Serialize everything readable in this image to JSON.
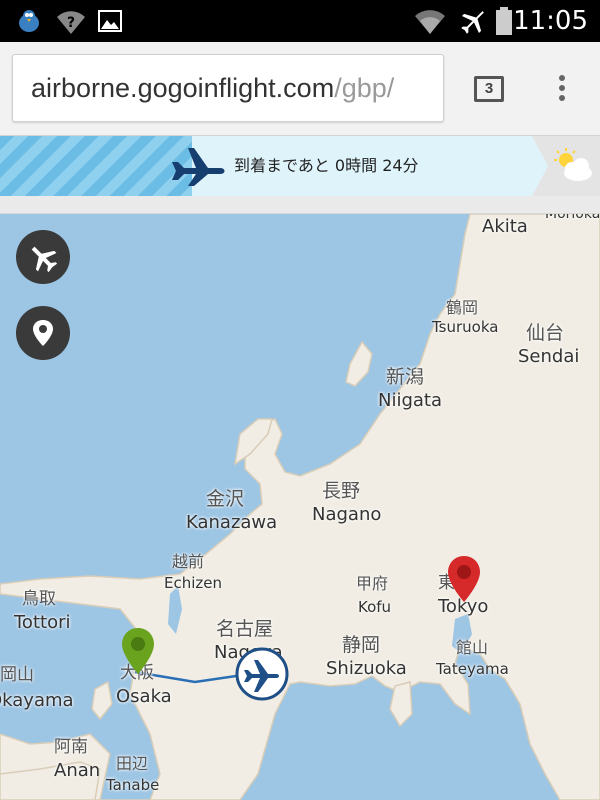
{
  "status_bar": {
    "time": "11:05",
    "icons": [
      "bird-notification-icon",
      "wifi-question-icon",
      "image-icon",
      "wifi-icon",
      "airplane-mode-icon",
      "battery-icon"
    ]
  },
  "browser": {
    "url_domain": "airborne.gogoinflight.com",
    "url_path": "/gbp/",
    "tab_count": "3",
    "icons": [
      "tab-counter-icon",
      "overflow-menu-icon"
    ]
  },
  "flight_banner": {
    "remaining_text": "到着まであと 0時間 24分",
    "weather_icon": "partly-cloudy-icon",
    "plane_icon": "airplane-icon"
  },
  "map": {
    "controls": [
      {
        "name": "flight-view-button",
        "icon": "airplane-icon"
      },
      {
        "name": "location-button",
        "icon": "location-pin-icon"
      }
    ],
    "labels": [
      {
        "id": "morioka",
        "text": "Morioka"
      },
      {
        "id": "akita",
        "text": "Akita"
      },
      {
        "id": "tsuruoka_jp",
        "text": "鶴岡"
      },
      {
        "id": "tsuruoka",
        "text": "Tsuruoka"
      },
      {
        "id": "sendai_jp",
        "text": "仙台"
      },
      {
        "id": "sendai",
        "text": "Sendai"
      },
      {
        "id": "niigata_jp",
        "text": "新潟"
      },
      {
        "id": "niigata",
        "text": "Niigata"
      },
      {
        "id": "nagano_jp",
        "text": "長野"
      },
      {
        "id": "nagano",
        "text": "Nagano"
      },
      {
        "id": "kanazawa_jp",
        "text": "金沢"
      },
      {
        "id": "kanazawa",
        "text": "Kanazawa"
      },
      {
        "id": "echizen_jp",
        "text": "越前"
      },
      {
        "id": "echizen",
        "text": "Echizen"
      },
      {
        "id": "tottori_jp",
        "text": "鳥取"
      },
      {
        "id": "tottori",
        "text": "Tottori"
      },
      {
        "id": "kofu_jp",
        "text": "甲府"
      },
      {
        "id": "kofu",
        "text": "Kofu"
      },
      {
        "id": "tokyo_jp",
        "text": "東京"
      },
      {
        "id": "tokyo",
        "text": "Tokyo"
      },
      {
        "id": "nagoya_jp",
        "text": "名古屋"
      },
      {
        "id": "nagoya",
        "text": "Nagoya"
      },
      {
        "id": "shizuoka_jp",
        "text": "静岡"
      },
      {
        "id": "shizuoka",
        "text": "Shizuoka"
      },
      {
        "id": "tateyama_jp",
        "text": "館山"
      },
      {
        "id": "tateyama",
        "text": "Tateyama"
      },
      {
        "id": "okayama_jp",
        "text": "岡山"
      },
      {
        "id": "okayama",
        "text": "Okayama"
      },
      {
        "id": "osaka_jp",
        "text": "大阪"
      },
      {
        "id": "osaka",
        "text": "Osaka"
      },
      {
        "id": "anan_jp",
        "text": "阿南"
      },
      {
        "id": "anan",
        "text": "Anan"
      },
      {
        "id": "tanabe_jp",
        "text": "田辺"
      },
      {
        "id": "tanabe",
        "text": "Tanabe"
      }
    ],
    "origin_pin_color": "#6aa31e",
    "destination_pin_color": "#d62a2a",
    "route_color": "#2a6fb5"
  }
}
